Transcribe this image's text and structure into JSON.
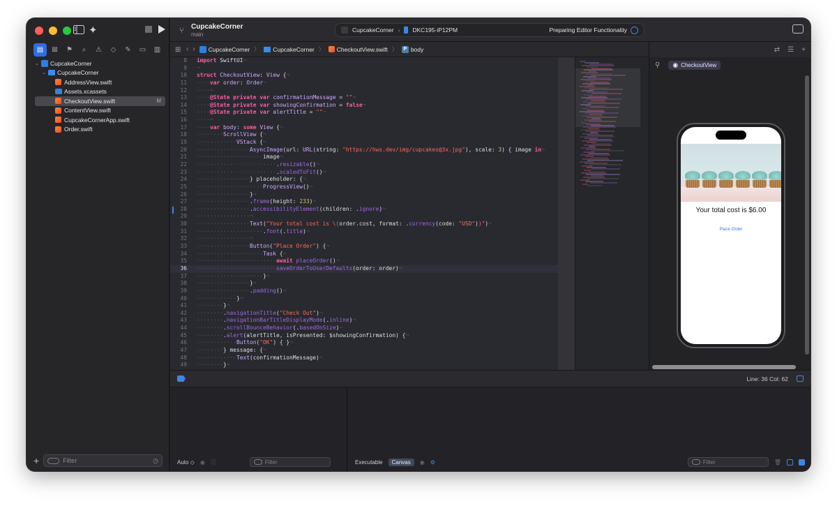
{
  "window": {
    "project_name": "CupcakeCorner",
    "branch": "main"
  },
  "scheme": {
    "target": "CupcakeCorner",
    "device": "DKC195-iP12PM",
    "status": "Preparing Editor Functionality"
  },
  "sidebar": {
    "items": [
      {
        "label": "CupcakeCorner",
        "icon": "project-icon",
        "indent": 0,
        "chevron": "⌄"
      },
      {
        "label": "CupcakeCorner",
        "icon": "folder-icon",
        "indent": 1,
        "chevron": "⌄"
      },
      {
        "label": "AddressView.swift",
        "icon": "swift-file-icon",
        "indent": 2,
        "chevron": ""
      },
      {
        "label": "Assets.xcassets",
        "icon": "assets-icon",
        "indent": 2,
        "chevron": ""
      },
      {
        "label": "CheckoutView.swift",
        "icon": "swift-file-icon",
        "indent": 2,
        "chevron": "",
        "badge": "M",
        "selected": true
      },
      {
        "label": "ContentView.swift",
        "icon": "swift-file-icon",
        "indent": 2,
        "chevron": ""
      },
      {
        "label": "CupcakeCornerApp.swift",
        "icon": "swift-file-icon",
        "indent": 2,
        "chevron": ""
      },
      {
        "label": "Order.swift",
        "icon": "swift-file-icon",
        "indent": 2,
        "chevron": ""
      }
    ],
    "filter_placeholder": "Filter"
  },
  "jumpbar": {
    "crumbs": [
      "CupcakeCorner",
      "CupcakeCorner",
      "CheckoutView.swift",
      "body"
    ]
  },
  "editor": {
    "lines": [
      {
        "n": "8",
        "code": "<span class=\"k\">import</span> SwiftUI<span class=\"w\">¬</span>"
      },
      {
        "n": "9",
        "code": "<span class=\"w\">¬</span>"
      },
      {
        "n": "10",
        "code": "<span class=\"k\">struct</span> <span class=\"t\">CheckoutView</span>: <span class=\"t\">View</span> {<span class=\"w\">¬</span>"
      },
      {
        "n": "11",
        "code": "<span class=\"w\">····</span><span class=\"k\">var</span> <span class=\"t\">order</span>: <span class=\"t\">Order</span><span class=\"w\">¬</span>"
      },
      {
        "n": "12",
        "code": "<span class=\"w\">····¬</span>"
      },
      {
        "n": "13",
        "code": "<span class=\"w\">····</span><span class=\"k\">@State</span> <span class=\"k\">private</span> <span class=\"k\">var</span> <span class=\"t\">confirmationMessage</span> = <span class=\"s\">\"\"</span><span class=\"w\">¬</span>"
      },
      {
        "n": "14",
        "code": "<span class=\"w\">····</span><span class=\"k\">@State</span> <span class=\"k\">private</span> <span class=\"k\">var</span> <span class=\"t\">showingConfirmation</span> = <span class=\"k\">false</span><span class=\"w\">¬</span>"
      },
      {
        "n": "15",
        "code": "<span class=\"w\">····</span><span class=\"k\">@State</span> <span class=\"k\">private</span> <span class=\"k\">var</span> <span class=\"t\">alertTitle</span> = <span class=\"s\">\"\"</span><span class=\"w\">¬</span>"
      },
      {
        "n": "16",
        "code": "<span class=\"w\">····¬</span>"
      },
      {
        "n": "17",
        "code": "<span class=\"w\">····</span><span class=\"k\">var</span> <span class=\"t\">body</span>: <span class=\"k\">some</span> <span class=\"t\">View</span> {<span class=\"w\">¬</span>"
      },
      {
        "n": "18",
        "code": "<span class=\"w\">········</span><span class=\"t\">ScrollView</span> {<span class=\"w\">¬</span>"
      },
      {
        "n": "19",
        "code": "<span class=\"w\">············</span><span class=\"t\">VStack</span> {<span class=\"w\">¬</span>"
      },
      {
        "n": "20",
        "code": "<span class=\"w\">················</span><span class=\"t\">AsyncImage</span>(url: <span class=\"t\">URL</span>(string: <span class=\"s\">\"https://hws.dev/img/cupcakes@3x.jpg\"</span>), scale: <span class=\"n\">3</span>) { image <span class=\"k\">in</span><span class=\"w\">¬</span>"
      },
      {
        "n": "21",
        "code": "<span class=\"w\">····················</span>image<span class=\"w\">¬</span>"
      },
      {
        "n": "22",
        "code": "<span class=\"w\">························</span>.<span class=\"f\">resizable</span>()<span class=\"w\">¬</span>"
      },
      {
        "n": "23",
        "code": "<span class=\"w\">························</span>.<span class=\"f\">scaledToFit</span>()<span class=\"w\">¬</span>"
      },
      {
        "n": "24",
        "code": "<span class=\"w\">················</span>} placeholder: {<span class=\"w\">¬</span>"
      },
      {
        "n": "25",
        "code": "<span class=\"w\">····················</span><span class=\"t\">ProgressView</span>()<span class=\"w\">¬</span>"
      },
      {
        "n": "26",
        "code": "<span class=\"w\">················</span>}<span class=\"w\">¬</span>"
      },
      {
        "n": "27",
        "code": "<span class=\"w\">················</span>.<span class=\"f\">frame</span>(height: <span class=\"n\">233</span>)<span class=\"w\">¬</span>"
      },
      {
        "n": "28",
        "code": "<span class=\"w\">················</span>.<span class=\"f\">accessibilityElement</span>(children: .<span class=\"f\">ignore</span>)<span class=\"w\">¬</span>"
      },
      {
        "n": "29",
        "code": "<span class=\"w\">················¬</span>"
      },
      {
        "n": "30",
        "code": "<span class=\"w\">················</span><span class=\"t\">Text</span>(<span class=\"s\">\"Your total cost is \\(</span>order.cost, format: .<span class=\"f\">currency</span>(code: <span class=\"s\">\"USD\"</span>)<span class=\"s\">)\"</span>)<span class=\"w\">¬</span>"
      },
      {
        "n": "31",
        "code": "<span class=\"w\">····················</span>.<span class=\"f\">font</span>(.<span class=\"f\">title</span>)<span class=\"w\">¬</span>"
      },
      {
        "n": "32",
        "code": "<span class=\"w\">················¬</span>"
      },
      {
        "n": "33",
        "code": "<span class=\"w\">················</span><span class=\"t\">Button</span>(<span class=\"s\">\"Place Order\"</span>) {<span class=\"w\">¬</span>"
      },
      {
        "n": "34",
        "code": "<span class=\"w\">····················</span><span class=\"t\">Task</span> {<span class=\"w\">¬</span>"
      },
      {
        "n": "35",
        "code": "<span class=\"w\">························</span><span class=\"k\">await</span> <span class=\"f\">placeOrder</span>()<span class=\"w\">¬</span>"
      },
      {
        "n": "36",
        "code": "<span class=\"w\">························</span><span class=\"f\">saveOrderToUserDefaults</span>(order: order)<span class=\"w\">¬</span>",
        "current": true
      },
      {
        "n": "37",
        "code": "<span class=\"w\">····················</span>}<span class=\"w\">¬</span>"
      },
      {
        "n": "38",
        "code": "<span class=\"w\">················</span>}<span class=\"w\">¬</span>"
      },
      {
        "n": "39",
        "code": "<span class=\"w\">················</span>.<span class=\"f\">padding</span>()<span class=\"w\">¬</span>"
      },
      {
        "n": "40",
        "code": "<span class=\"w\">············</span>}<span class=\"w\">¬</span>"
      },
      {
        "n": "41",
        "code": "<span class=\"w\">········</span>}<span class=\"w\">¬</span>"
      },
      {
        "n": "42",
        "code": "<span class=\"w\">········</span>.<span class=\"f\">navigationTitle</span>(<span class=\"s\">\"Check Out\"</span>)<span class=\"w\">¬</span>"
      },
      {
        "n": "43",
        "code": "<span class=\"w\">········</span>.<span class=\"f\">navigationBarTitleDisplayMode</span>(.<span class=\"f\">inline</span>)<span class=\"w\">¬</span>"
      },
      {
        "n": "44",
        "code": "<span class=\"w\">········</span>.<span class=\"f\">scrollBounceBehavior</span>(.<span class=\"f\">basedOnSize</span>)<span class=\"w\">¬</span>"
      },
      {
        "n": "45",
        "code": "<span class=\"w\">········</span>.<span class=\"f\">alert</span>(alertTitle, isPresented: $showingConfirmation) {<span class=\"w\">¬</span>"
      },
      {
        "n": "46",
        "code": "<span class=\"w\">············</span><span class=\"t\">Button</span>(<span class=\"s\">\"OK\"</span>) { }<span class=\"w\">¬</span>"
      },
      {
        "n": "47",
        "code": "<span class=\"w\">········</span>} message: {<span class=\"w\">¬</span>"
      },
      {
        "n": "48",
        "code": "<span class=\"w\">············</span><span class=\"t\">Text</span>(confirmationMessage)<span class=\"w\">¬</span>"
      },
      {
        "n": "49",
        "code": "<span class=\"w\">········</span>}<span class=\"w\">¬</span>"
      }
    ]
  },
  "canvas": {
    "preview_label": "CheckoutView",
    "total_text": "Your total cost is $6.00",
    "button_text": "Place Order"
  },
  "statusbar": {
    "line_col": "Line: 36  Col: 62"
  },
  "debug": {
    "auto_label": "Auto ◇",
    "filter_placeholder": "Filter",
    "executable_label": "Executable",
    "canvas_label": "Canvas"
  },
  "colors": {
    "accent": "#2f6de1",
    "editor_bg": "#292a30",
    "keyword": "#fc5fa3",
    "string": "#fc6a5d"
  }
}
